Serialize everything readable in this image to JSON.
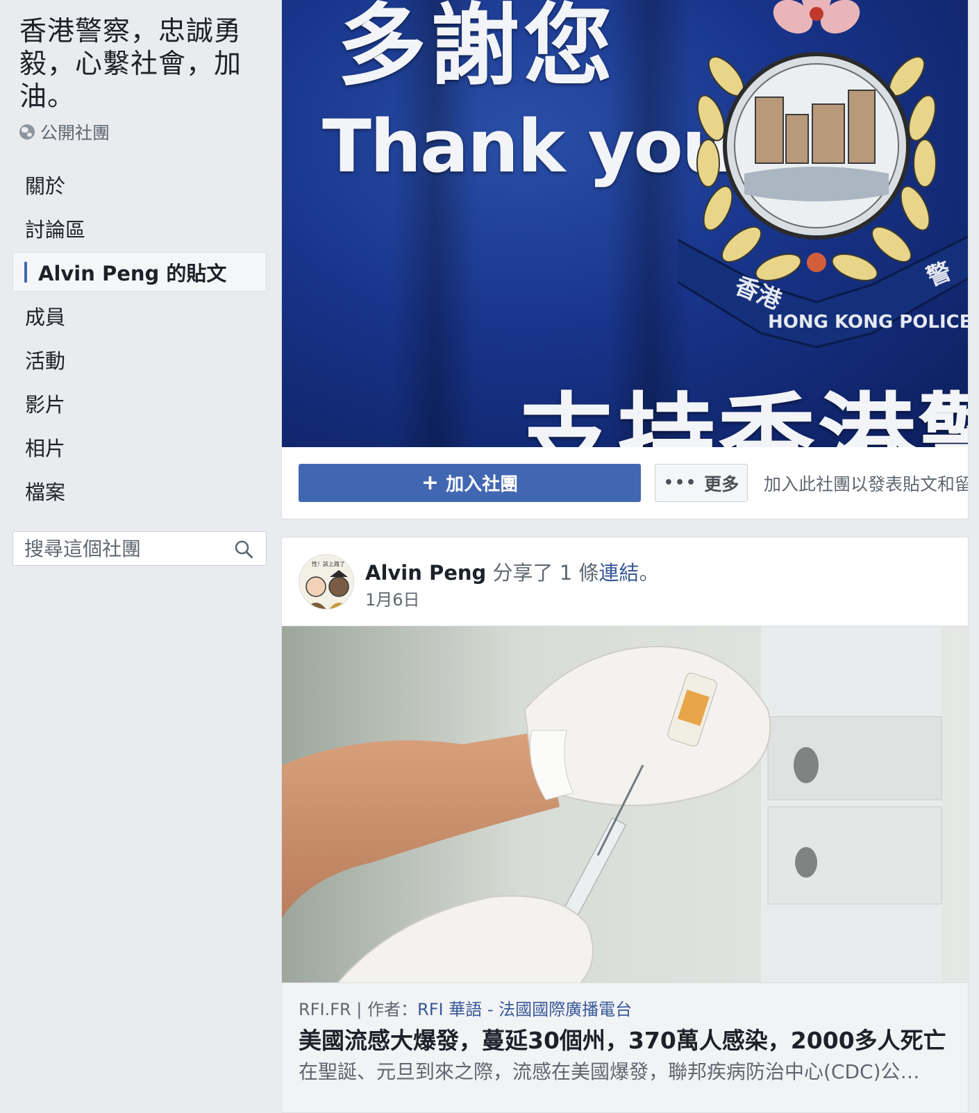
{
  "sidebar": {
    "group_title": "香港警察，忠誠勇毅，心繫社會，加油。",
    "privacy": "公開社團",
    "nav": [
      {
        "label": "關於"
      },
      {
        "label": "討論區"
      },
      {
        "label": "Alvin Peng 的貼文",
        "active": true
      },
      {
        "label": "成員"
      },
      {
        "label": "活動"
      },
      {
        "label": "影片"
      },
      {
        "label": "相片"
      },
      {
        "label": "檔案"
      }
    ],
    "search_placeholder": "搜尋這個社團"
  },
  "cover": {
    "text_top": "多謝您",
    "text_thanks": "Thank you",
    "text_bottom": "支持香港警",
    "emblem_banner_left": "香港",
    "emblem_banner_center": "HONG KONG POLICE",
    "emblem_banner_right": "警"
  },
  "actions": {
    "join_label": "加入社團",
    "more_label": "更多",
    "join_hint": "加入此社團以發表貼文和留言。"
  },
  "post": {
    "author": "Alvin Peng",
    "action_text": " 分享了 1 條",
    "link_word": "連結",
    "end_punct": "。",
    "date": "1月6日",
    "avatar_caption": "性！該上路了",
    "preview": {
      "domain": "RFI.FR",
      "separator": " | 作者：",
      "source_name": "RFI 華語 - 法國國際廣播電台",
      "title": "美國流感大爆發，蔓延30個州，370萬人感染，2000多人死亡",
      "description": "在聖誕、元旦到來之際，流感在美國爆發，聯邦疾病防治中心(CDC)公佈..."
    }
  },
  "colors": {
    "brand_blue": "#4267b2",
    "link_blue": "#385898",
    "page_bg": "#e9ebee"
  }
}
